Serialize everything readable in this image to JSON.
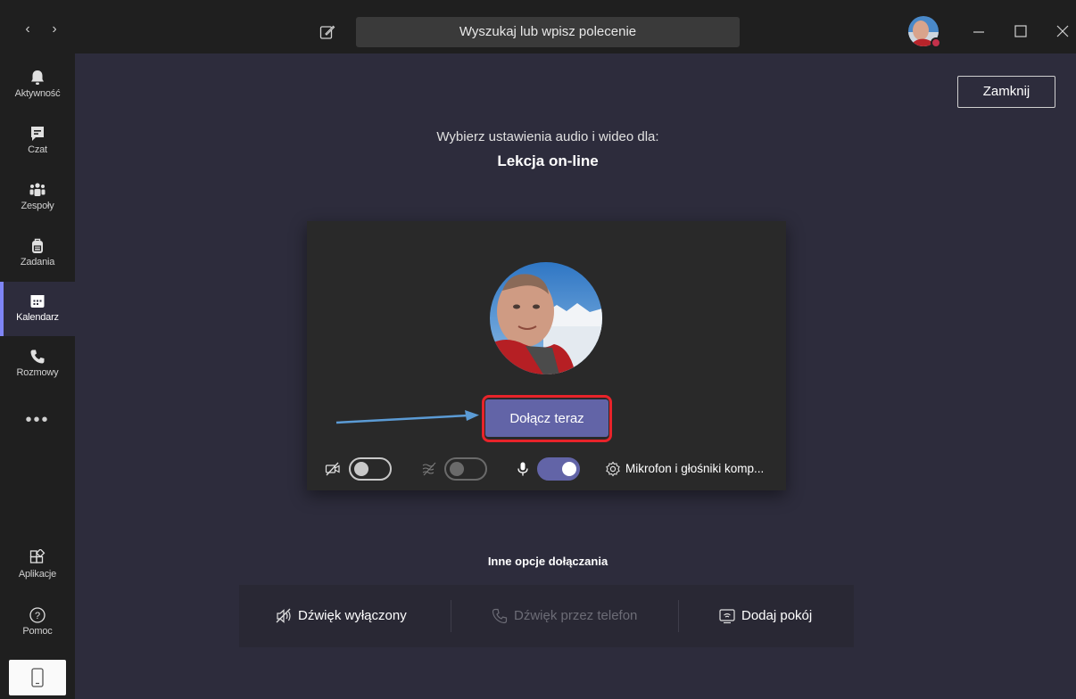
{
  "titlebar": {
    "back_icon": "chevron-left-icon",
    "forward_icon": "chevron-right-icon",
    "compose_icon": "compose-icon",
    "search_placeholder": "Wyszukaj lub wpisz polecenie",
    "status_color": "#c4314b"
  },
  "sidebar": {
    "items": [
      {
        "label": "Aktywność",
        "icon": "bell-icon"
      },
      {
        "label": "Czat",
        "icon": "chat-icon"
      },
      {
        "label": "Zespoły",
        "icon": "teams-icon"
      },
      {
        "label": "Zadania",
        "icon": "backpack-icon"
      },
      {
        "label": "Kalendarz",
        "icon": "calendar-icon",
        "active": true
      },
      {
        "label": "Rozmowy",
        "icon": "phone-icon"
      }
    ],
    "more": "•••",
    "bottom_items": [
      {
        "label": "Aplikacje",
        "icon": "apps-icon"
      },
      {
        "label": "Pomoc",
        "icon": "help-icon"
      }
    ]
  },
  "main": {
    "close_label": "Zamknij",
    "subtitle": "Wybierz ustawienia audio i wideo dla:",
    "meeting_title": "Lekcja on-line",
    "join_label": "Dołącz teraz",
    "device_label": "Mikrofon i głośniki komp...",
    "video_on": false,
    "blur_on": false,
    "mic_on": true,
    "other_options_label": "Inne opcje dołączania",
    "options": [
      {
        "label": "Dźwięk wyłączony",
        "icon": "speaker-off-icon",
        "enabled": true
      },
      {
        "label": "Dźwięk przez telefon",
        "icon": "phone-icon",
        "enabled": false
      },
      {
        "label": "Dodaj pokój",
        "icon": "room-icon",
        "enabled": true
      }
    ]
  },
  "colors": {
    "accent": "#6264a7",
    "highlight": "#e8232a",
    "arrow": "#5b9bd5"
  }
}
